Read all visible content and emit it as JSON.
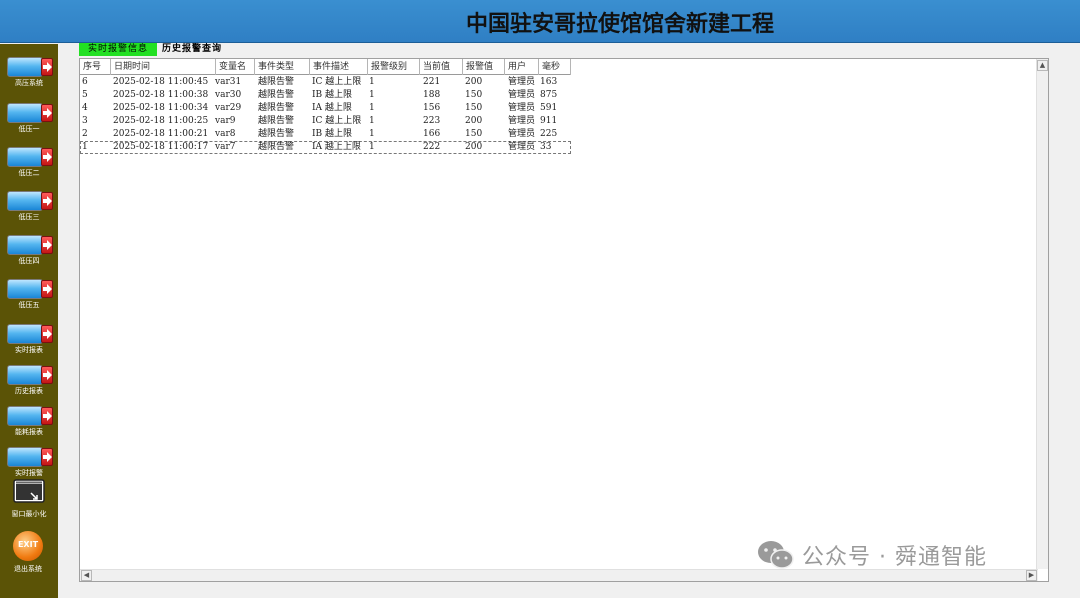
{
  "header": {
    "title": "中国驻安哥拉使馆馆舍新建工程"
  },
  "sidebar": {
    "items": [
      {
        "label": "高压系统",
        "icon": "nav-arrow-icon"
      },
      {
        "label": "低压一",
        "icon": "nav-arrow-icon"
      },
      {
        "label": "低压二",
        "icon": "nav-arrow-icon"
      },
      {
        "label": "低压三",
        "icon": "nav-arrow-icon"
      },
      {
        "label": "低压四",
        "icon": "nav-arrow-icon"
      },
      {
        "label": "低压五",
        "icon": "nav-arrow-icon"
      },
      {
        "label": "实时报表",
        "icon": "nav-arrow-icon"
      },
      {
        "label": "历史报表",
        "icon": "nav-arrow-icon"
      },
      {
        "label": "能耗报表",
        "icon": "nav-arrow-icon"
      },
      {
        "label": "实时报警",
        "icon": "nav-arrow-icon"
      }
    ],
    "minimize_label": "窗口最小化",
    "exit_label": "退出系统",
    "exit_icon_text": "EXIT"
  },
  "tabs": [
    {
      "label": "实时报警信息",
      "active": true
    },
    {
      "label": "历史报警查询",
      "active": false
    }
  ],
  "table": {
    "columns": [
      "序号",
      "日期时间",
      "变量名",
      "事件类型",
      "事件描述",
      "报警级别",
      "当前值",
      "报警值",
      "用户",
      "毫秒"
    ],
    "rows": [
      [
        "6",
        "2025-02-18 11:00:45",
        "var31",
        "越限告警",
        "IC 越上上限",
        "1",
        "221",
        "200",
        "管理员",
        "163"
      ],
      [
        "5",
        "2025-02-18 11:00:38",
        "var30",
        "越限告警",
        "IB 越上限",
        "1",
        "188",
        "150",
        "管理员",
        "875"
      ],
      [
        "4",
        "2025-02-18 11:00:34",
        "var29",
        "越限告警",
        "IA 越上限",
        "1",
        "156",
        "150",
        "管理员",
        "591"
      ],
      [
        "3",
        "2025-02-18 11:00:25",
        "var9",
        "越限告警",
        "IC 越上上限",
        "1",
        "223",
        "200",
        "管理员",
        "911"
      ],
      [
        "2",
        "2025-02-18 11:00:21",
        "var8",
        "越限告警",
        "IB 越上限",
        "1",
        "166",
        "150",
        "管理员",
        "225"
      ],
      [
        "1",
        "2025-02-18 11:00:17",
        "var7",
        "越限告警",
        "IA 越上上限",
        "1",
        "222",
        "200",
        "管理员",
        "33"
      ]
    ]
  },
  "watermark": {
    "text": "公众号 · 舜通智能",
    "icon": "wechat-icon"
  },
  "colors": {
    "header": "#2f7fc4",
    "sidebar": "#5b5306",
    "active_tab": "#22e022"
  }
}
